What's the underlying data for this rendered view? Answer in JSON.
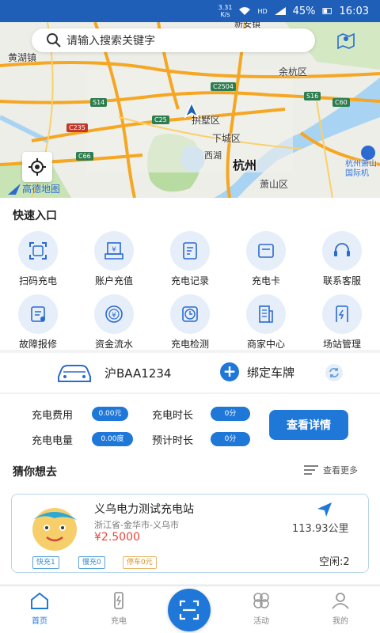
{
  "status_bar": {
    "speed_value": "3.31",
    "speed_unit": "K/s",
    "network": "HD",
    "battery": "45%",
    "time": "16:03"
  },
  "map": {
    "search_placeholder": "请输入搜索关键字",
    "labels": {
      "town1": "黄湖镇",
      "town2": "余杭区",
      "district1": "拱墅区",
      "district2": "下城区",
      "lake": "西湖",
      "city": "杭州",
      "district3": "萧山区",
      "airport": "杭州萧山国际机",
      "top_label": "新安镇"
    },
    "roads": [
      "S14",
      "C2504",
      "S16",
      "C60",
      "C25",
      "C235",
      "C66"
    ],
    "logo_text": "高德地图"
  },
  "quick_entry": {
    "title": "快速入口",
    "items": [
      {
        "label": "扫码充电",
        "icon": "scan-icon"
      },
      {
        "label": "账户充值",
        "icon": "recharge-icon"
      },
      {
        "label": "充电记录",
        "icon": "record-icon"
      },
      {
        "label": "充电卡",
        "icon": "card-icon"
      },
      {
        "label": "联系客服",
        "icon": "headset-icon"
      },
      {
        "label": "故障报修",
        "icon": "repair-icon"
      },
      {
        "label": "资金流水",
        "icon": "money-flow-icon"
      },
      {
        "label": "充电检测",
        "icon": "clock-icon"
      },
      {
        "label": "商家中心",
        "icon": "merchant-icon"
      },
      {
        "label": "场站管理",
        "icon": "station-icon"
      }
    ]
  },
  "vehicle": {
    "plate": "沪BAA1234",
    "bind_label": "绑定车牌"
  },
  "charge_info": {
    "fee_label": "充电费用",
    "fee_value": "0.00元",
    "duration_label": "充电时长",
    "duration_value": "0分",
    "energy_label": "充电电量",
    "energy_value": "0.00度",
    "estimate_label": "预计时长",
    "estimate_value": "0分",
    "detail_button": "查看详情"
  },
  "guess": {
    "title": "猜你想去",
    "more_label": "查看更多",
    "station": {
      "name": "义乌电力测试充电站",
      "address": "浙江省-金华市-义乌市",
      "price": "¥2.5000",
      "distance": "113.93公里",
      "tags": [
        "快充1",
        "慢充0",
        "停车0元"
      ],
      "idle": "空闲:2"
    }
  },
  "bottom_nav": {
    "items": [
      "首页",
      "充电",
      "活动",
      "我的"
    ],
    "active": 0
  },
  "colors": {
    "primary": "#1f78d8",
    "price": "#e8463a",
    "status_bar": "#1f5fb8"
  }
}
